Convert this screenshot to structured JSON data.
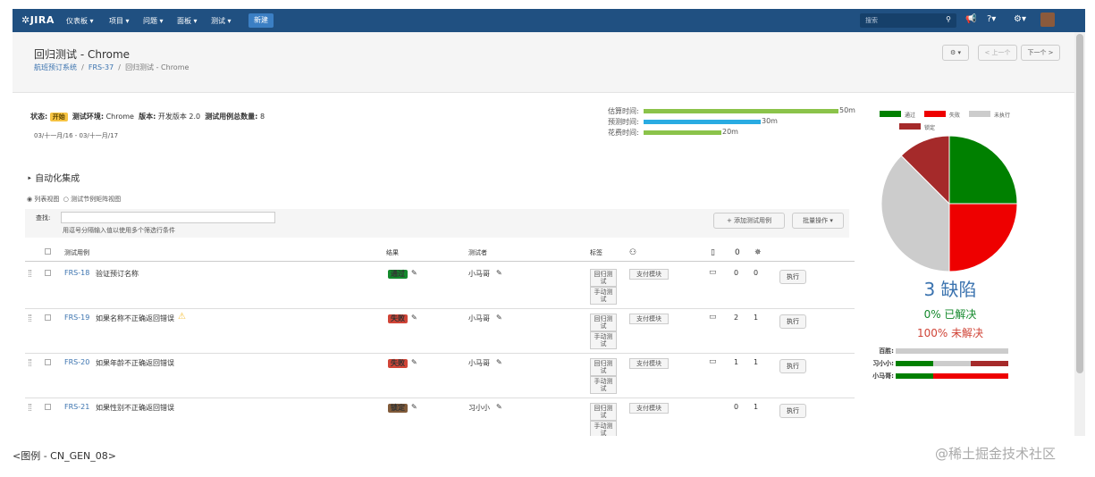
{
  "nav": {
    "logo": "JIRA",
    "menus": [
      "仪表板 ▾",
      "项目 ▾",
      "问题 ▾",
      "面板 ▾",
      "测试 ▾"
    ],
    "create": "新建",
    "search_placeholder": "搜索",
    "icons": [
      "search-icon",
      "notification-icon",
      "help-icon",
      "gear-icon"
    ]
  },
  "header": {
    "title": "回归测试 - Chrome",
    "breadcrumb": [
      "航班预订系统",
      "FRS-37",
      "回归测试 - Chrome"
    ],
    "prev": "< 上一个",
    "next": "下一个 >"
  },
  "summary": {
    "status_label": "状态:",
    "status_value": "开始",
    "env_label": "测试环境:",
    "env_value": "Chrome",
    "version_label": "版本:",
    "version_value": "开发版本 2.0",
    "count_label": "测试用例总数量:",
    "count_value": "8",
    "dates": "03/十一月/16 - 03/十一月/17",
    "time": [
      {
        "label": "估算时间:",
        "value": "50m",
        "minutes": 50,
        "color": "#8bc34a"
      },
      {
        "label": "预测时间:",
        "value": "30m",
        "minutes": 30,
        "color": "#29abe2"
      },
      {
        "label": "花费时间:",
        "value": "20m",
        "minutes": 20,
        "color": "#8bc34a"
      }
    ]
  },
  "section": {
    "title": "自动化集成",
    "view_list": "列表视图",
    "view_matrix": "测试节例矩阵视图",
    "filter_label": "查找:",
    "filter_hint": "用逗号分隔输入值以使用多个筛选行条件",
    "add_button": "+ 添加测试用例",
    "batch_button": "批量操作 ▾"
  },
  "table": {
    "headers": [
      "测试用例",
      "结果",
      "测试者",
      "标签",
      "",
      "",
      "",
      ""
    ],
    "rows": [
      {
        "key": "FRS-18",
        "summary": "验证预订名称",
        "warn": false,
        "result": "通过",
        "result_color": "#14892c",
        "tester": "小马哥",
        "tags": [
          "回归测试",
          "手动测试"
        ],
        "module": "支付模块",
        "comments": "0",
        "defects": "0",
        "exec": "执行",
        "has_comment_icon": true
      },
      {
        "key": "FRS-19",
        "summary": "如果名称不正确返回错误",
        "warn": true,
        "result": "失败",
        "result_color": "#d04437",
        "tester": "小马哥",
        "tags": [
          "回归测试",
          "手动测试"
        ],
        "module": "支付模块",
        "comments": "2",
        "defects": "1",
        "exec": "执行",
        "has_comment_icon": true
      },
      {
        "key": "FRS-20",
        "summary": "如果年龄不正确返回错误",
        "warn": false,
        "result": "失败",
        "result_color": "#d04437",
        "tester": "小马哥",
        "tags": [
          "回归测试",
          "手动测试"
        ],
        "module": "支付模块",
        "comments": "1",
        "defects": "1",
        "exec": "执行",
        "has_comment_icon": true
      },
      {
        "key": "FRS-21",
        "summary": "如果性别不正确返回错误",
        "warn": false,
        "result": "锁定",
        "result_color": "#815b3a",
        "tester": "习小小",
        "tags": [
          "回归测试",
          "手动测试"
        ],
        "module": "支付模块",
        "comments": "0",
        "defects": "1",
        "exec": "执行",
        "has_comment_icon": false
      }
    ]
  },
  "panel": {
    "legend": [
      {
        "label": "通过",
        "color": "#008000"
      },
      {
        "label": "失败",
        "color": "#ee0000"
      },
      {
        "label": "未执行",
        "color": "#cccccc"
      },
      {
        "label": "锁定",
        "color": "#a52a2a"
      }
    ],
    "pie": [
      {
        "label": "通过",
        "value": 2,
        "color": "#008000"
      },
      {
        "label": "失败",
        "value": 2,
        "color": "#ee0000"
      },
      {
        "label": "未执行",
        "value": 3,
        "color": "#cccccc"
      },
      {
        "label": "锁定",
        "value": 1,
        "color": "#a52a2a"
      }
    ],
    "defects": "3 缺陷",
    "resolved": "0% 已解决",
    "unresolved": "100% 未解决",
    "testers": [
      {
        "name": "百胜:",
        "segments": [
          {
            "value": 1,
            "color": "#cccccc"
          }
        ]
      },
      {
        "name": "习小小:",
        "segments": [
          {
            "value": 1,
            "color": "#008000"
          },
          {
            "value": 1,
            "color": "#cccccc"
          },
          {
            "value": 1,
            "color": "#a52a2a"
          }
        ]
      },
      {
        "name": "小马哥:",
        "segments": [
          {
            "value": 1,
            "color": "#008000"
          },
          {
            "value": 2,
            "color": "#ee0000"
          }
        ]
      }
    ]
  },
  "footer": {
    "caption": "<图例 - CN_GEN_08>",
    "watermark": "@稀土掘金技术社区"
  }
}
